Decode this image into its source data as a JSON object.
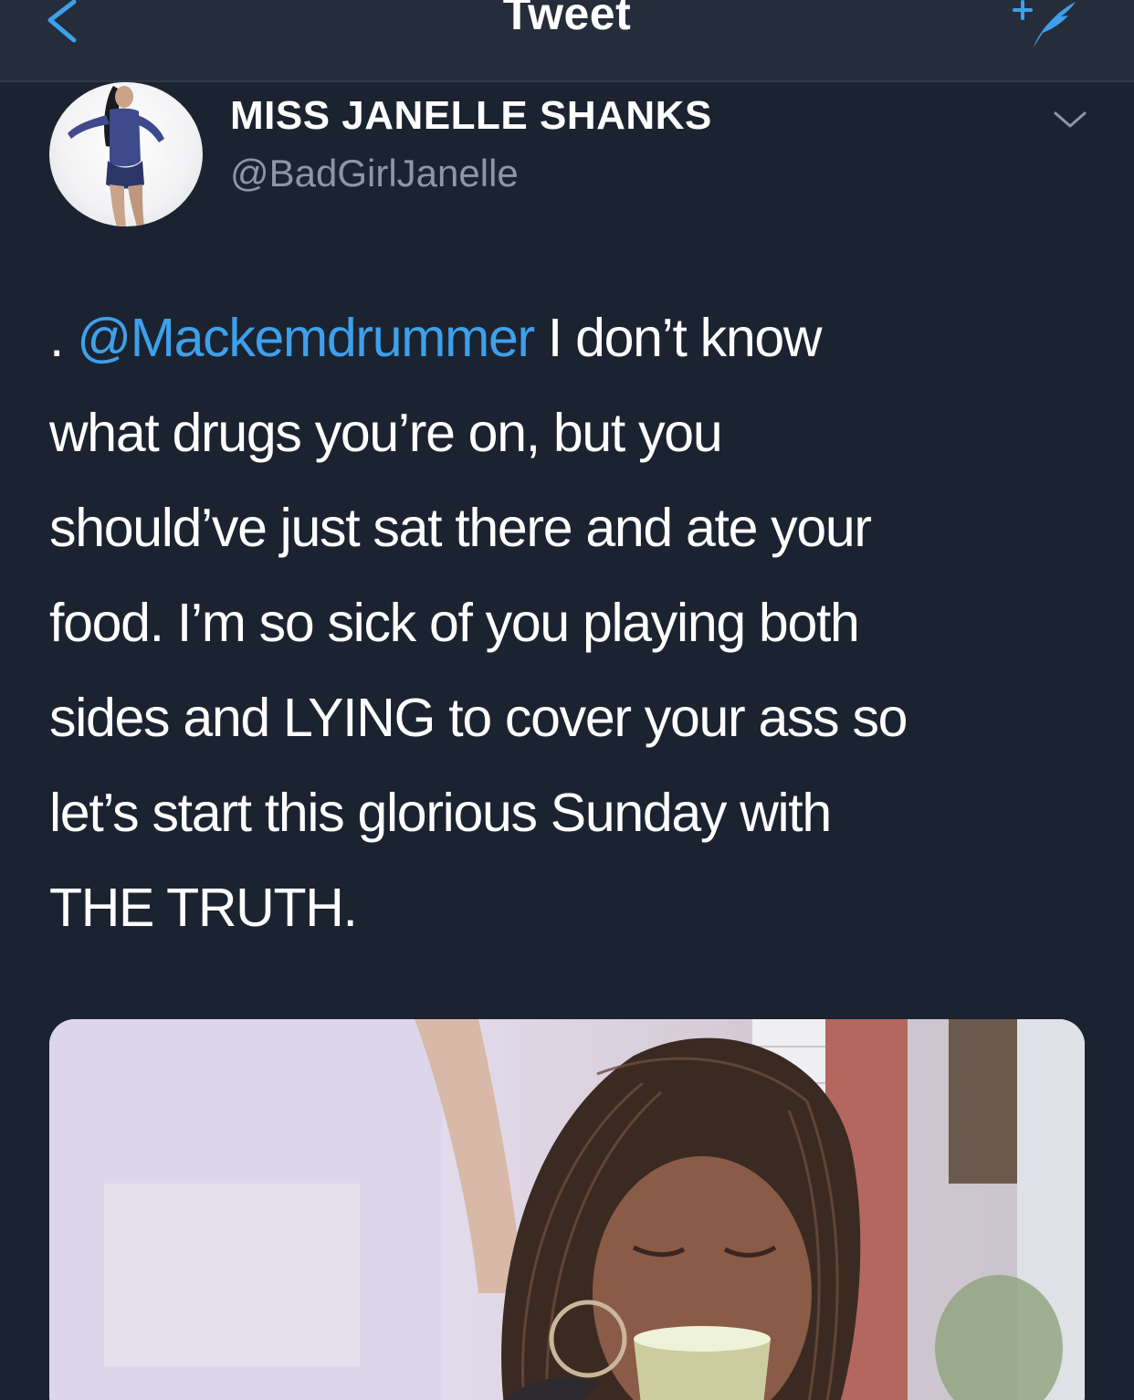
{
  "nav": {
    "title": "Tweet",
    "back_icon": "chevron-left-icon",
    "compose_icon": "compose-tweet-icon"
  },
  "author": {
    "display_name": "MISS JANELLE SHANKS",
    "handle": "@BadGirlJanelle",
    "avatar_icon": "avatar",
    "menu_icon": "chevron-down-icon"
  },
  "tweet": {
    "line1_prefix": ".",
    "mention": "@Mackemdrummer",
    "line1_suffix": " I don’t know",
    "lines": [
      "what drugs you’re on, but you",
      "should’ve just sat there and ate your",
      "food. I’m so sick of you playing both",
      "sides and LYING to cover your ass so",
      "let’s start this glorious Sunday with",
      "THE TRUTH."
    ]
  },
  "colors": {
    "background": "#1c2330",
    "navbar": "#252d3a",
    "accent": "#3ea0eb",
    "secondary_text": "#8b97a7"
  }
}
